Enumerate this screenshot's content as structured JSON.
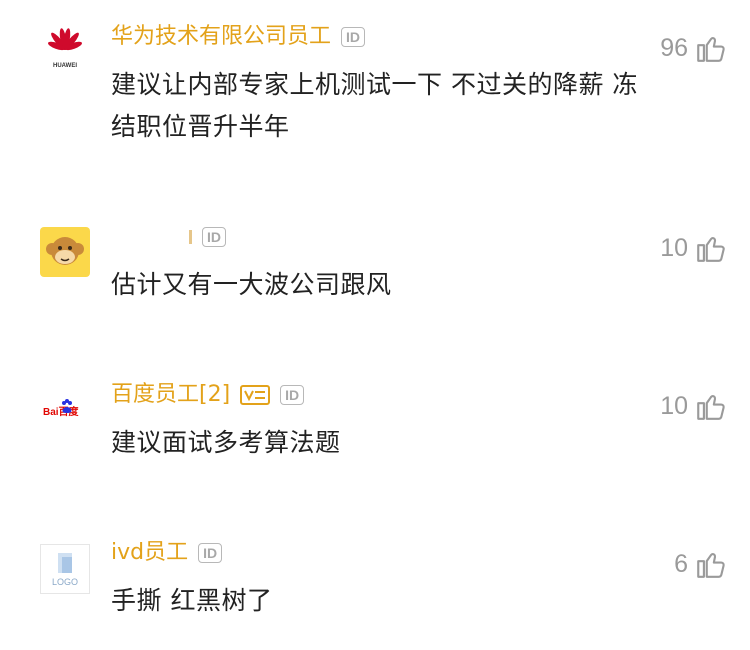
{
  "comments": [
    {
      "username": "华为技术有限公司员工",
      "id_label": "ID",
      "avatar_logo_text": "HUAWEI",
      "text": "建议让内部专家上机测试一下 不过关的降薪 冻结职位晋升半年",
      "likes": "96"
    },
    {
      "username": "",
      "id_label": "ID",
      "text": "估计又有一大波公司跟风",
      "likes": "10"
    },
    {
      "username": "百度员工[2]",
      "id_label": "ID",
      "avatar_logo_text": "Bai百度",
      "text": "建议面试多考算法题",
      "likes": "10"
    },
    {
      "username": "ivd员工",
      "id_label": "ID",
      "avatar_logo_text": "LOGO",
      "text": "手撕 红黑树了",
      "likes": "6"
    }
  ],
  "colors": {
    "username": "#e3a21a",
    "text": "#222222",
    "likes": "#9a9a9a",
    "huawei_red": "#cf0a2c",
    "baidu_blue": "#2932e1",
    "baidu_red": "#e10602"
  },
  "icons": {
    "like": "thumbs-up-icon",
    "vip": "verified-badge-icon"
  }
}
